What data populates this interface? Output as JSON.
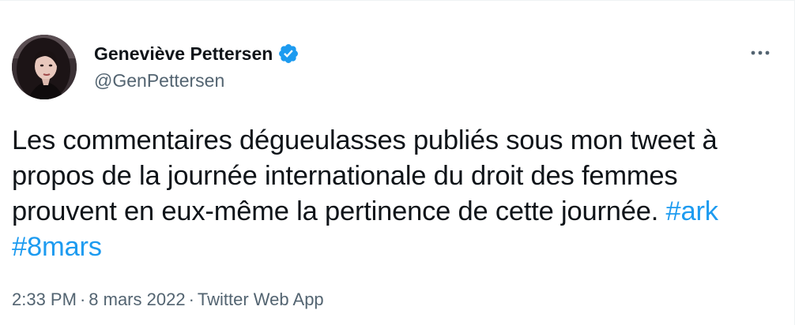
{
  "author": {
    "display_name": "Geneviève Pettersen",
    "handle": "@GenPettersen",
    "verified": true,
    "verified_icon": "verified-badge-icon",
    "verified_color": "#1d9bf0"
  },
  "more_icon": "more-horizontal-icon",
  "tweet": {
    "text_before": "Les commentaires dégueulasses publiés sous mon tweet à propos de la journée internationale du droit des femmes prouvent en eux-même la pertinence de cette journée. ",
    "hashtags": [
      "#ark",
      "#8mars"
    ],
    "hashtag_color": "#1d9bf0"
  },
  "meta": {
    "time": "2:33 PM",
    "date": "8 mars 2022",
    "source": "Twitter Web App",
    "separator": "·"
  }
}
